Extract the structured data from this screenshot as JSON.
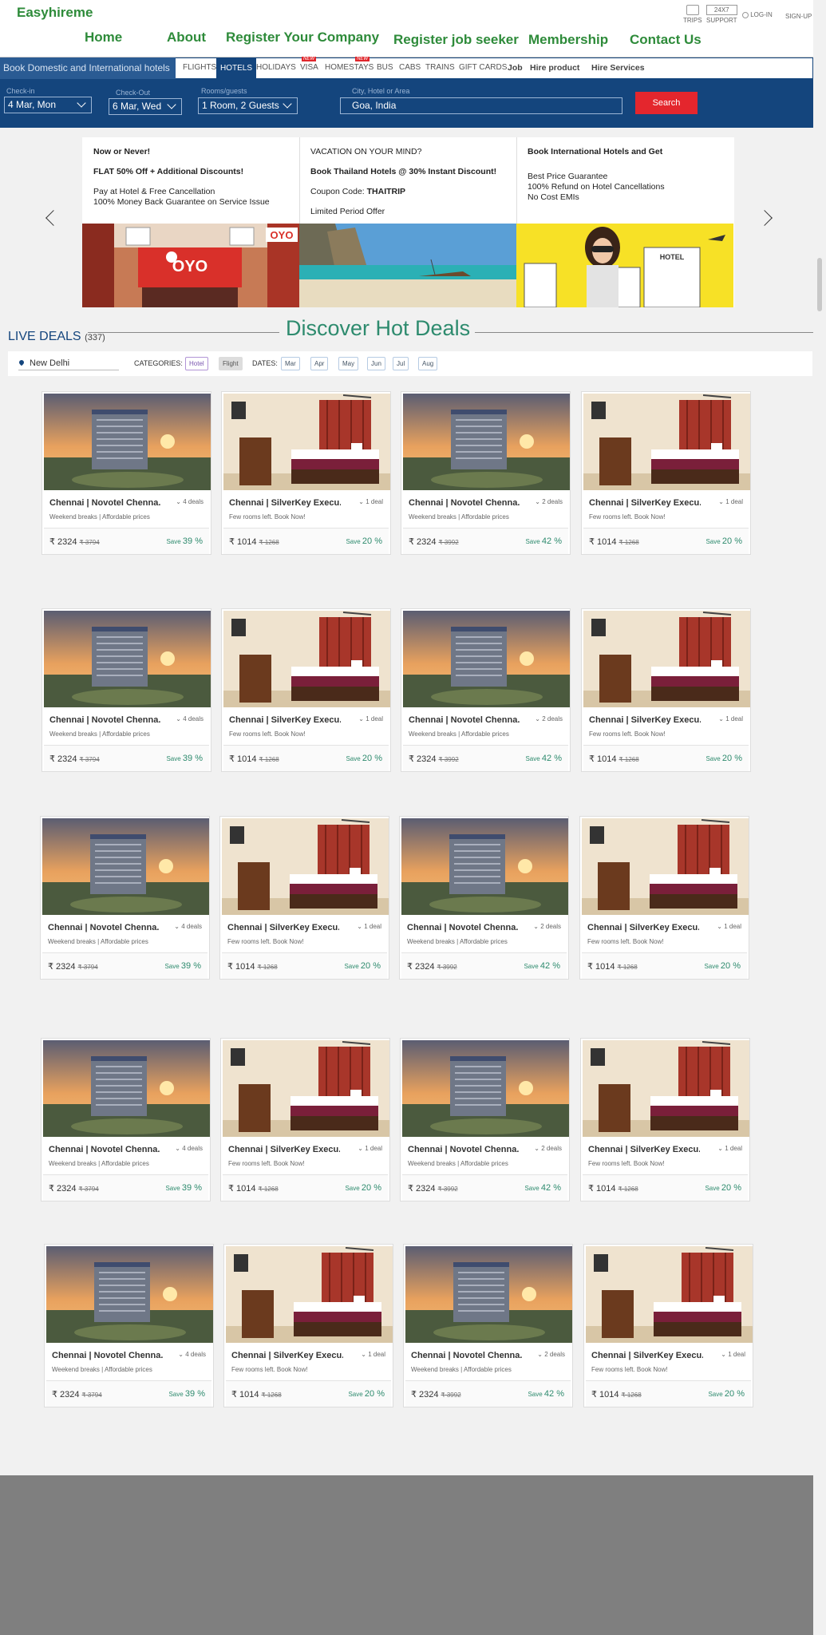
{
  "brand": "Easyhireme",
  "nav": [
    "Home",
    "About",
    "Register Your Company",
    "Register job seeker",
    "Membership",
    "Contact Us"
  ],
  "utility": {
    "trips": "TRIPS",
    "support_box": "24X7",
    "support": "SUPPORT",
    "login": "LOG-IN",
    "signup": "SIGN-UP"
  },
  "booking": {
    "tagline": "Book Domestic and International hotels",
    "tabs": [
      "FLIGHTS",
      "HOTELS",
      "HOLIDAYS",
      "VISA",
      "HOMESTAYS",
      "BUS",
      "CABS",
      "TRAINS",
      "GIFT CARDS",
      "Job",
      "Hire product",
      "Hire Services"
    ],
    "active_tab": "HOTELS",
    "new_badge": "NEW",
    "checkin_label": "Check-in",
    "checkin_value": "4 Mar, Mon",
    "checkout_label": "Check-Out",
    "checkout_value": "6 Mar, Wed",
    "rooms_label": "Rooms/guests",
    "rooms_value": "1 Room, 2 Guests",
    "city_label": "City, Hotel or Area",
    "city_value": "Goa, India",
    "search_label": "Search"
  },
  "promos": [
    {
      "lines": [
        "Now or Never!",
        "FLAT 50% Off + Additional Discounts!",
        "Pay at Hotel & Free Cancellation",
        "100% Money Back Guarantee on Service Issue"
      ],
      "sign": "OYO"
    },
    {
      "lines": [
        "VACATION ON YOUR MIND?",
        "Book Thailand Hotels @ 30% Instant Discount!",
        "Coupon Code:",
        "THAITRIP",
        "Limited Period Offer"
      ]
    },
    {
      "lines": [
        "Book International Hotels and Get",
        "Best Price Guarantee",
        "100% Refund on Hotel Cancellations",
        "No Cost EMIs"
      ],
      "sign": "HOTEL"
    }
  ],
  "deals": {
    "heading": "Discover Hot Deals",
    "live_label": "LIVE DEALS",
    "live_count": "(337)",
    "location": "New Delhi",
    "categories_label": "CATEGORIES:",
    "categories": [
      "Hotel",
      "Flight"
    ],
    "dates_label": "DATES:",
    "months": [
      "Mar",
      "Apr",
      "May",
      "Jun",
      "Jul",
      "Aug"
    ]
  },
  "cards": [
    {
      "name": "Chennai | Novotel Chenna...",
      "deals": "4 deals",
      "desc": "Weekend breaks | Affordable prices",
      "price": "₹ 2324",
      "old": "₹ 3794",
      "save_prefix": "Save",
      "save": "39 %",
      "img": "hotel"
    },
    {
      "name": "Chennai | SilverKey Execu...",
      "deals": "1 deal",
      "desc": "Few rooms left. Book Now!",
      "price": "₹ 1014",
      "old": "₹ 1268",
      "save_prefix": "Save",
      "save": "20 %",
      "img": "room"
    },
    {
      "name": "Chennai | Novotel Chenna...",
      "deals": "2 deals",
      "desc": "Weekend breaks | Affordable prices",
      "price": "₹ 2324",
      "old": "₹ 3992",
      "save_prefix": "Save",
      "save": "42 %",
      "img": "hotel"
    },
    {
      "name": "Chennai | SilverKey Execu...",
      "deals": "1 deal",
      "desc": "Few rooms left. Book Now!",
      "price": "₹ 1014",
      "old": "₹ 1268",
      "save_prefix": "Save",
      "save": "20 %",
      "img": "room"
    }
  ],
  "colors": {
    "brand_green": "#2e8b3a",
    "navy": "#14457d",
    "search_red": "#e4262d",
    "save_green": "#2e8b6e"
  }
}
